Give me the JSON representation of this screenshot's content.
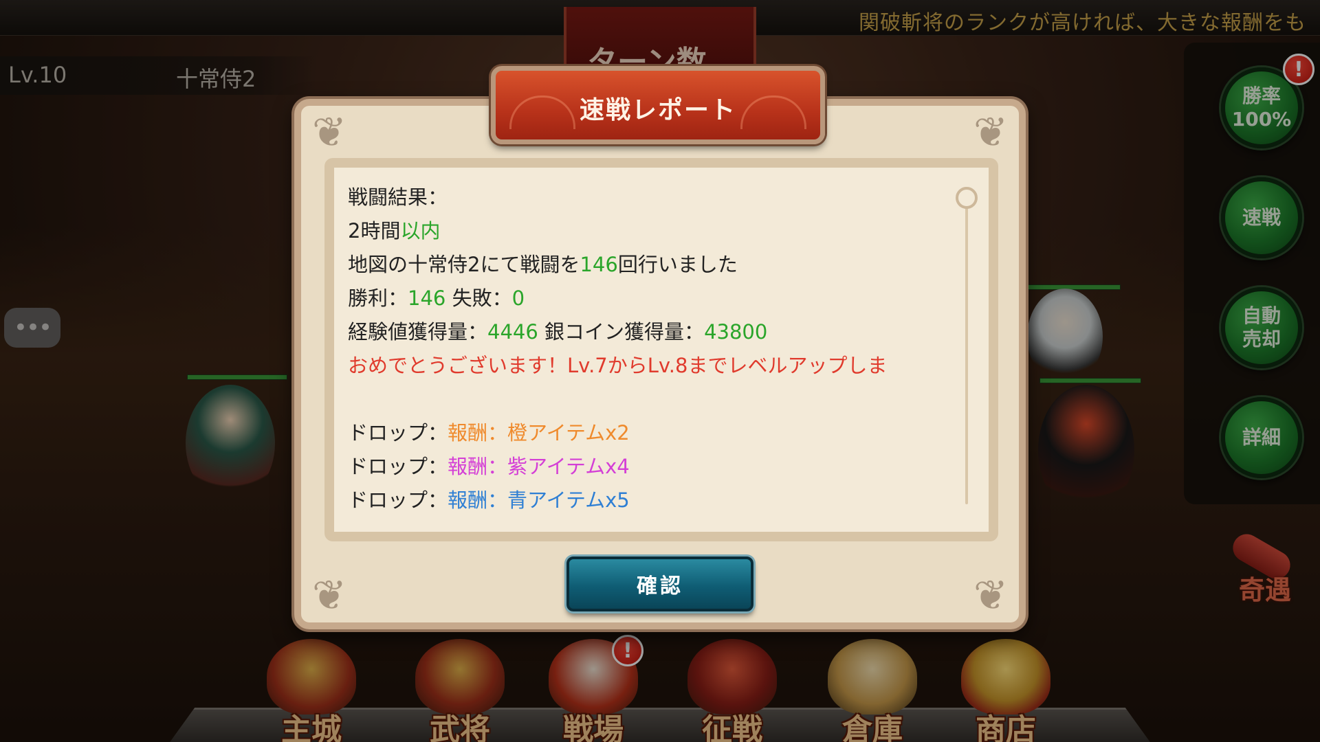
{
  "top": {
    "notice": "関破斬将のランクが高ければ、大きな報酬をも",
    "turn_banner": "ターン数",
    "level": "Lv.10",
    "stage": "十常侍2"
  },
  "side": {
    "win_rate": "勝率\n100%",
    "quick_battle": "速戦",
    "auto_sell": "自動\n売却",
    "details": "詳細",
    "alert": "!",
    "chat": "•••",
    "kiguu": "奇遇"
  },
  "dialog": {
    "title": "速戦レポート",
    "confirm": "確認",
    "result_label": "戦闘結果：",
    "duration": {
      "prefix": "2時間",
      "value": "以内"
    },
    "battles": {
      "prefix": "地図の十常侍2にて戦闘を",
      "count": "146",
      "suffix": "回行いました"
    },
    "record": {
      "win_label": "勝利：",
      "wins": "146",
      "loss_label": "失敗：",
      "losses": "0"
    },
    "gains": {
      "exp_label": "経験値獲得量：",
      "exp": "4446",
      "coin_label": "銀コイン獲得量：",
      "coins": "43800"
    },
    "levelup": "おめでとうございます！Lv.7からLv.8までレベルアップしま",
    "drops": [
      {
        "label": "ドロップ：",
        "value": "報酬：橙アイテムx2",
        "color": "#ef8a2c"
      },
      {
        "label": "ドロップ：",
        "value": "報酬：紫アイテムx4",
        "color": "#d43fd6"
      },
      {
        "label": "ドロップ：",
        "value": "報酬：青アイテムx5",
        "color": "#2e7fd4"
      }
    ]
  },
  "nav": {
    "items": [
      {
        "label": "主城"
      },
      {
        "label": "武将"
      },
      {
        "label": "戦場"
      },
      {
        "label": "征戦"
      },
      {
        "label": "倉庫"
      },
      {
        "label": "商店"
      }
    ],
    "alert": "!"
  },
  "colors": {
    "accent_green": "#2aa52a",
    "alert_red": "#e03a2c",
    "title_red": "#c23a1e",
    "confirm_teal": "#0f5d74"
  }
}
